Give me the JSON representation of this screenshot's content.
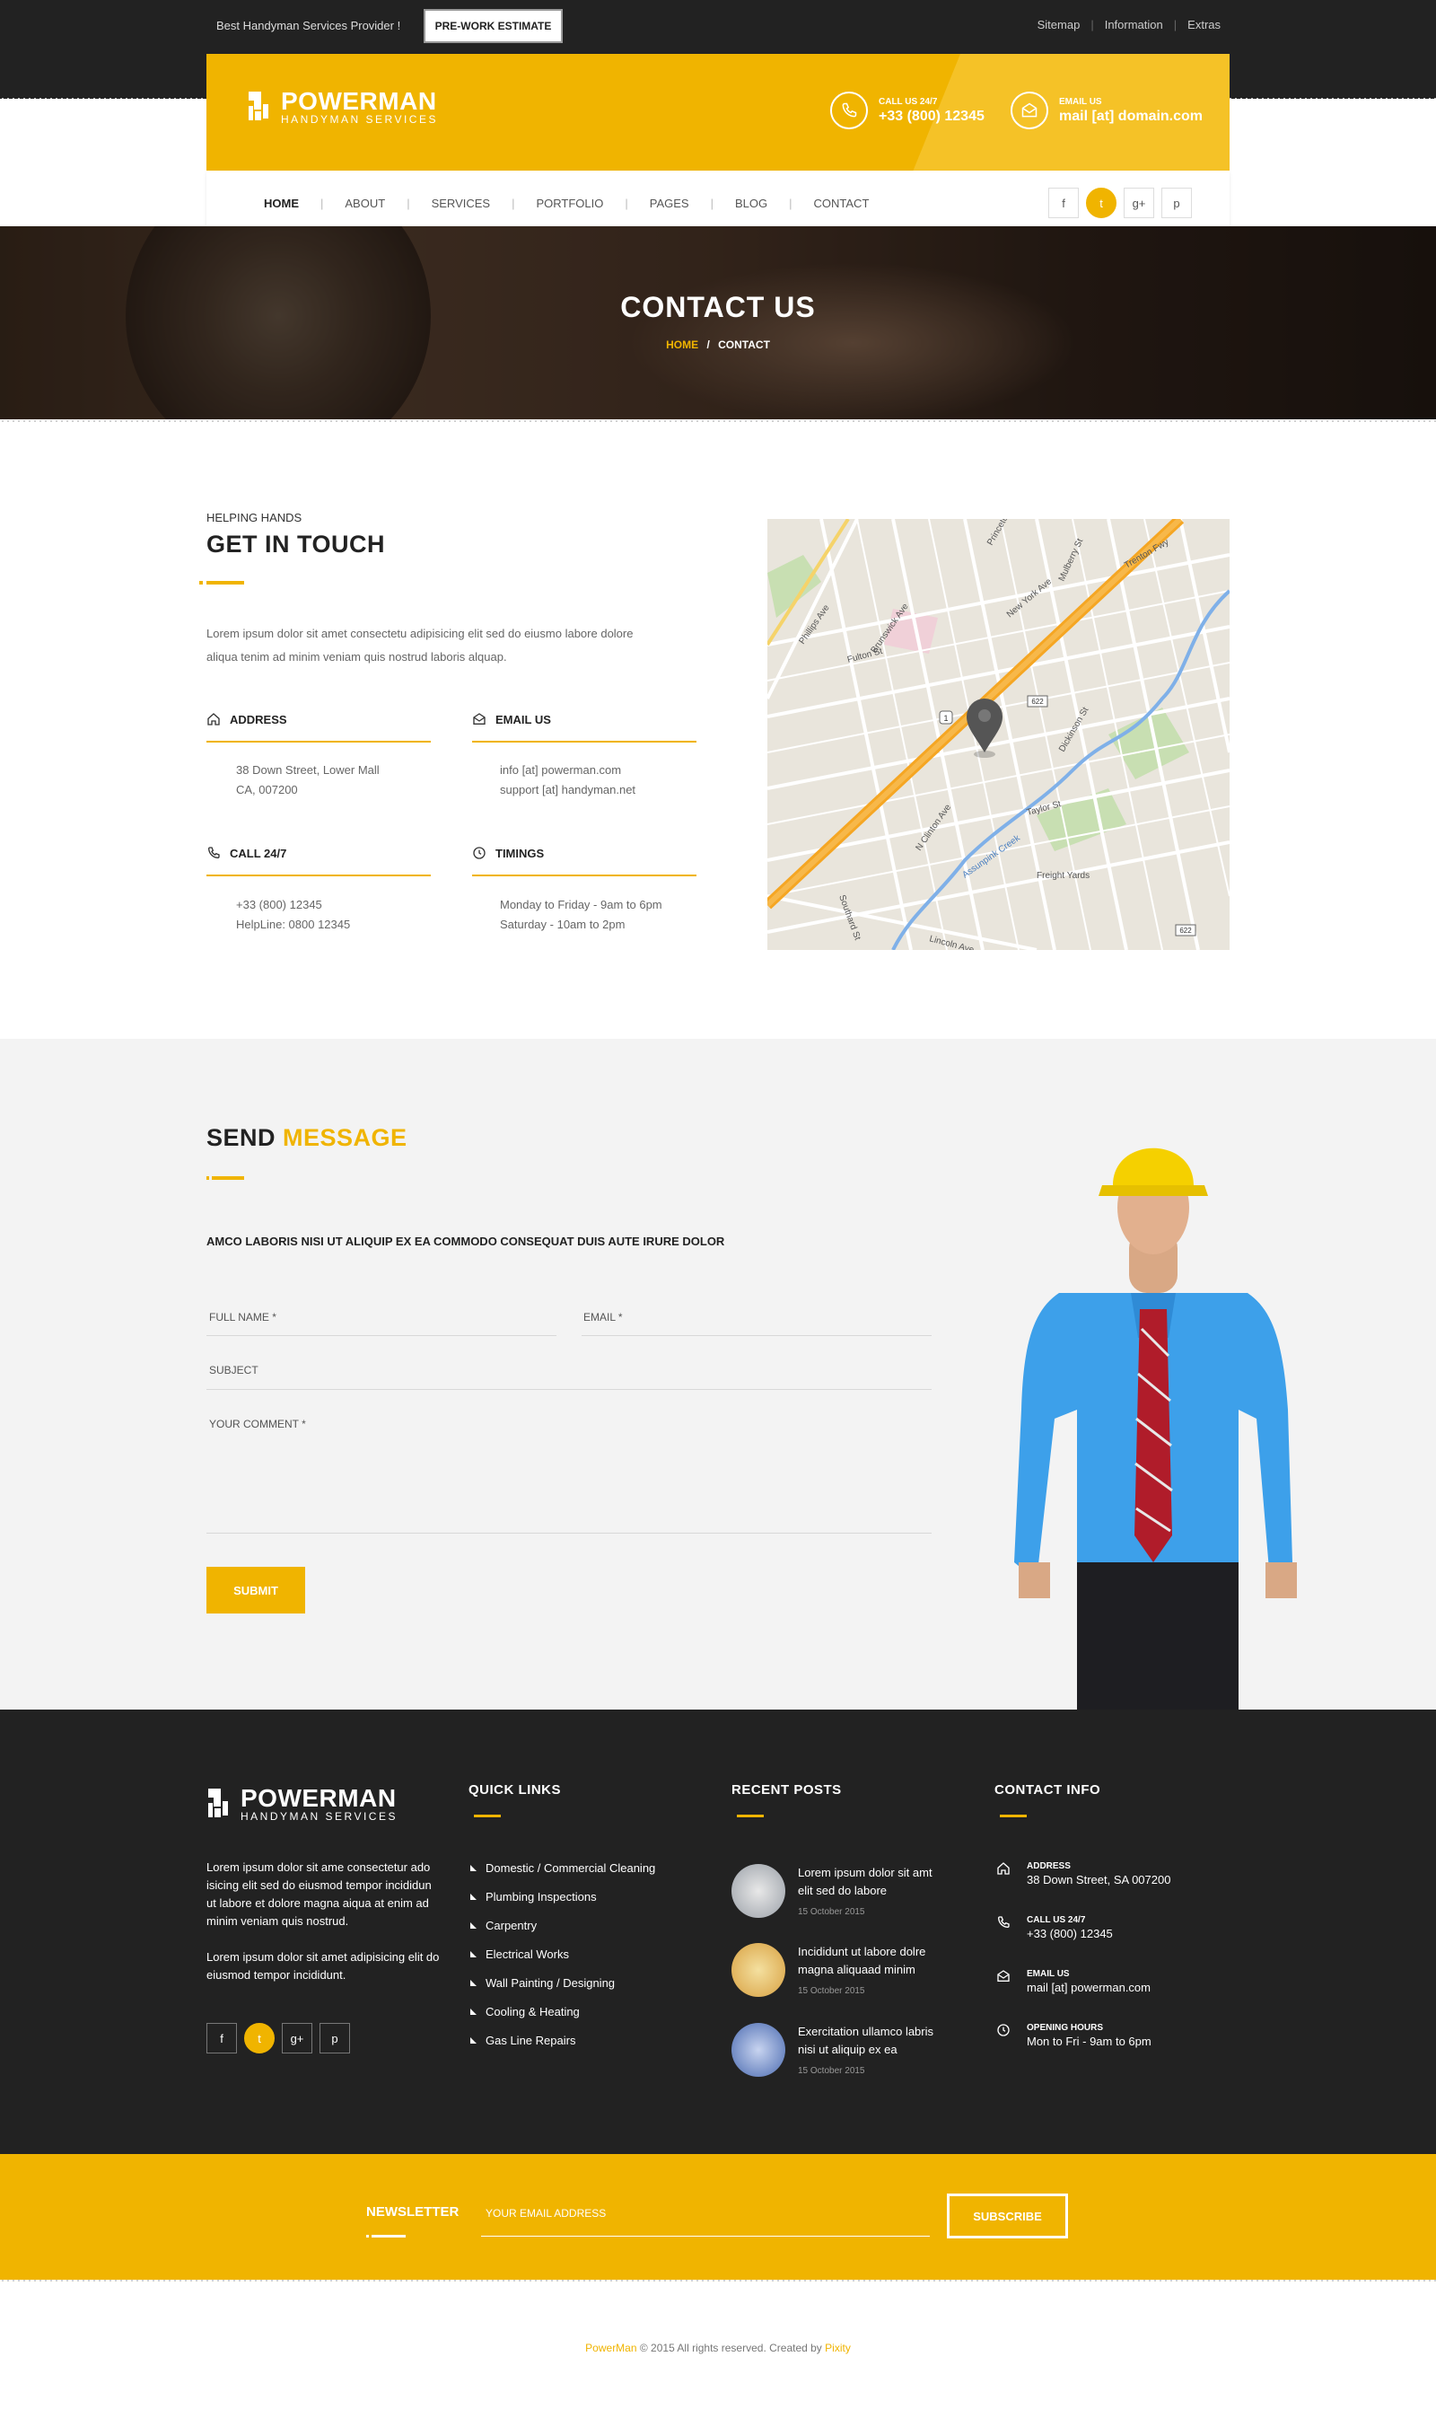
{
  "topbar": {
    "tagline": "Best Handyman Services Provider !",
    "estimate_button": "PRE-WORK ESTIMATE",
    "links": [
      "Sitemap",
      "Information",
      "Extras"
    ]
  },
  "header": {
    "logo_title": "POWERMAN",
    "logo_subtitle": "HANDYMAN SERVICES",
    "call_label": "CALL US 24/7",
    "call_value": "+33 (800) 12345",
    "email_label": "EMAIL US",
    "email_value": "mail [at] domain.com"
  },
  "nav": {
    "items": [
      "HOME",
      "ABOUT",
      "SERVICES",
      "PORTFOLIO",
      "PAGES",
      "BLOG",
      "CONTACT"
    ],
    "social": [
      "f",
      "t",
      "g+",
      "p"
    ]
  },
  "hero": {
    "title": "CONTACT US",
    "breadcrumb_home": "HOME",
    "breadcrumb_sep": "/",
    "breadcrumb_current": "CONTACT"
  },
  "contact": {
    "overline": "HELPING HANDS",
    "title": "GET IN TOUCH",
    "paragraph_1": "Lorem ipsum dolor sit amet consectetu adipisicing elit sed do eiusmo labore dolore",
    "paragraph_2": "aliqua tenim ad minim veniam quis nostrud laboris alquap.",
    "address_title": "ADDRESS",
    "address_line1": "38 Down Street, Lower Mall",
    "address_line2": "CA, 007200",
    "email_title": "EMAIL US",
    "email_line1": "info [at] powerman.com",
    "email_line2": "support [at] handyman.net",
    "call_title": "CALL 24/7",
    "call_line1": "+33 (800) 12345",
    "call_line2": "HelpLine: 0800 12345",
    "timings_title": "TIMINGS",
    "timings_line1": "Monday to Friday  -  9am to 6pm",
    "timings_line2": "Saturday  -  10am to 2pm"
  },
  "map": {
    "streets": [
      "Brunswick Ave",
      "New York Ave",
      "Mulberry St",
      "Trenton Fwy",
      "N Clinton Ave",
      "Lincoln Ave",
      "Assunpink Creek",
      "Freight Yards",
      "Taylor St",
      "Dickinson St",
      "Fulton St",
      "Phillips Ave",
      "Princeton Ave",
      "Southard St"
    ],
    "shields": [
      "1",
      "622",
      "622"
    ]
  },
  "message": {
    "title_1": "SEND",
    "title_2": "MESSAGE",
    "subtitle": "AMCO LABORIS NISI UT ALIQUIP EX EA COMMODO CONSEQUAT DUIS AUTE IRURE DOLOR",
    "fullname_placeholder": "FULL NAME *",
    "email_placeholder": "EMAIL *",
    "subject_placeholder": "SUBJECT",
    "comment_placeholder": "YOUR COMMENT *",
    "submit": "SUBMIT"
  },
  "footer": {
    "logo_title": "POWERMAN",
    "logo_subtitle": "HANDYMAN SERVICES",
    "about_1": "Lorem ipsum dolor sit ame consectetur ado isicing elit sed do eiusmod tempor incididun ut labore et dolore magna aiqua at enim ad minim veniam quis nostrud.",
    "about_2": "Lorem ipsum dolor sit amet adipisicing elit do eiusmod tempor incididunt.",
    "social": [
      "f",
      "t",
      "g+",
      "p"
    ],
    "quick_links_title": "QUICK LINKS",
    "quick_links": [
      "Domestic / Commercial Cleaning",
      "Plumbing Inspections",
      "Carpentry",
      "Electrical Works",
      "Wall Painting / Designing",
      "Cooling & Heating",
      "Gas Line Repairs"
    ],
    "recent_posts_title": "RECENT POSTS",
    "posts": [
      {
        "title": "Lorem ipsum dolor sit amt elit sed do labore",
        "date": "15 October 2015"
      },
      {
        "title": "Incididunt ut labore dolre magna aliquaad minim",
        "date": "15 October 2015"
      },
      {
        "title": "Exercitation ullamco labris nisi ut aliquip ex ea",
        "date": "15 October 2015"
      }
    ],
    "contact_info_title": "CONTACT INFO",
    "contact_items": [
      {
        "label": "ADDRESS",
        "value": "38 Down Street, SA 007200"
      },
      {
        "label": "CALL US 24/7",
        "value": "+33 (800) 12345"
      },
      {
        "label": "EMAIL US",
        "value": "mail [at] powerman.com"
      },
      {
        "label": "OPENING HOURS",
        "value": "Mon to Fri  -  9am to 6pm"
      }
    ]
  },
  "newsletter": {
    "title": "NEWSLETTER",
    "placeholder": "YOUR EMAIL ADDRESS",
    "button": "SUBSCRIBE"
  },
  "copyright": {
    "brand": "PowerMan",
    "text": " © 2015  All rights reserved. Created by ",
    "author": "Pixity"
  },
  "colors": {
    "accent": "#f0b400",
    "dark": "#222222",
    "section_gray": "#f3f3f3"
  }
}
